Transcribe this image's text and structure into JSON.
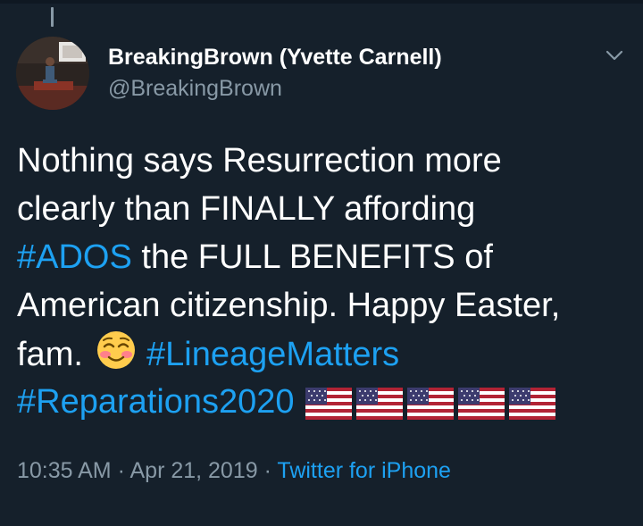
{
  "tweet": {
    "author": {
      "display_name": "BreakingBrown (Yvette Carnell)",
      "handle": "@BreakingBrown"
    },
    "text": {
      "l1": "Nothing says Resurrection more",
      "l2": "clearly than FINALLY affording",
      "l3_tag": "#ADOS",
      "l3_rest": " the FULL BENEFITS of",
      "l4": "American citizenship. Happy Easter,",
      "l5_text": "fam.",
      "l5_tag": "#LineageMatters",
      "l6_tag": "#Reparations2020"
    },
    "emojis": [
      "smiling-face-with-blush",
      "us-flag",
      "us-flag",
      "us-flag",
      "us-flag",
      "us-flag"
    ],
    "meta": {
      "time": "10:35 AM",
      "sep1": " · ",
      "date": "Apr 21, 2019",
      "sep2": " · ",
      "source": "Twitter for iPhone"
    }
  },
  "colors": {
    "background": "#15202b",
    "text": "#ffffff",
    "secondary": "#8899a6",
    "link": "#1da1f2"
  },
  "icons": [
    "chevron-down-icon"
  ]
}
